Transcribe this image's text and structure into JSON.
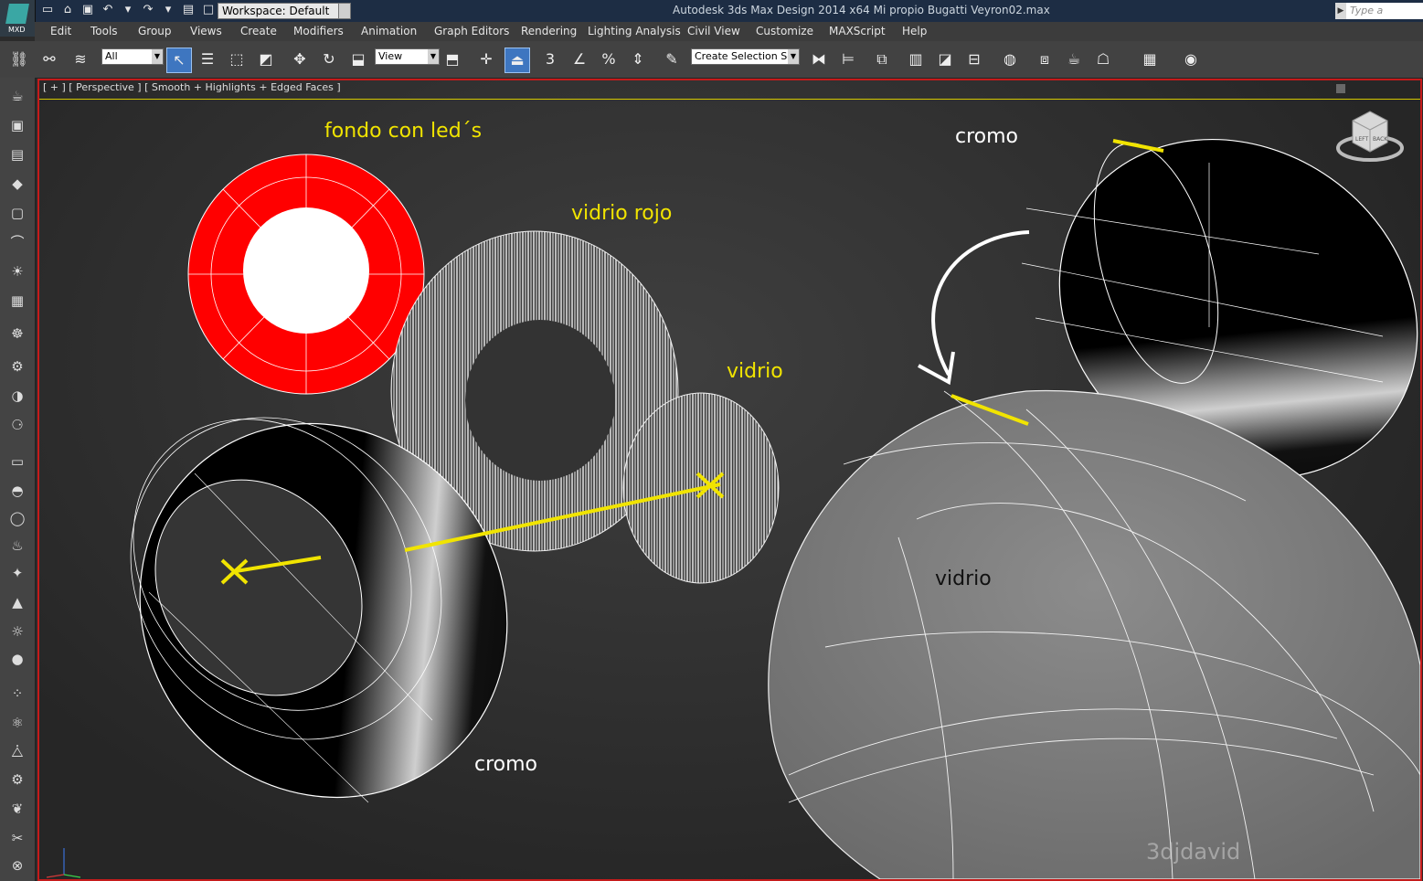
{
  "app": {
    "logo_label": "MXD",
    "workspace": "Workspace: Default",
    "title": "Autodesk 3ds Max Design 2014 x64     Mi propio Bugatti Veyron02.max",
    "search_placeholder": "Type a keyword o"
  },
  "menu": [
    "Edit",
    "Tools",
    "Group",
    "Views",
    "Create",
    "Modifiers",
    "Animation",
    "Graph Editors",
    "Rendering",
    "Lighting Analysis",
    "Civil View",
    "Customize",
    "MAXScript",
    "Help"
  ],
  "toolbar": {
    "filter_value": "All",
    "refcoord_value": "View",
    "selection_set_value": "Create Selection Se",
    "snap_label": "3",
    "percent_snap_label": "%"
  },
  "viewport": {
    "label": "[ + ] [ Perspective ] [ Smooth + Highlights + Edged Faces ]",
    "watermark": "3djdavid",
    "annotations": {
      "fondo": "fondo con led´s",
      "vidrio_rojo": "vidrio rojo",
      "vidrio_small": "vidrio",
      "cromo_top": "cromo",
      "cromo_bottom": "cromo",
      "vidrio_big": "vidrio"
    },
    "viewcube_labels": {
      "left": "LEFT",
      "back": "BACK"
    }
  },
  "colors": {
    "accent_yellow": "#f1e400",
    "viewport_border": "#c51b1b",
    "active_tool": "#3e76c0",
    "led_red": "#ff0000"
  }
}
